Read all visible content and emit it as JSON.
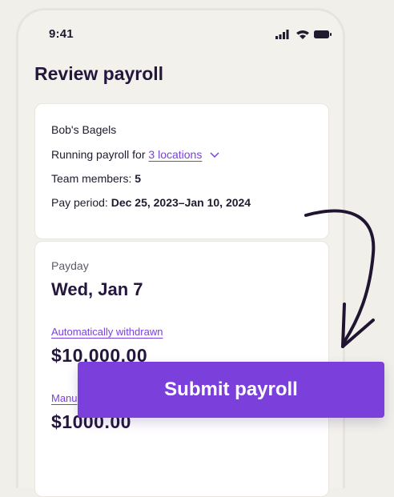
{
  "status_bar": {
    "time": "9:41",
    "icons": [
      "signal-icon",
      "wifi-icon",
      "battery-icon"
    ]
  },
  "page": {
    "title": "Review payroll"
  },
  "summary_card": {
    "company": "Bob's Bagels",
    "running_prefix": "Running payroll for",
    "locations_link": "3 locations",
    "team_label": "Team members:",
    "team_count": "5",
    "period_label": "Pay period:",
    "period_value": "Dec 25, 2023–Jan 10, 2024"
  },
  "payday_card": {
    "label": "Payday",
    "date": "Wed, Jan 7",
    "auto_label": "Automatically withdrawn",
    "auto_amount": "$10,000.00",
    "manual_label": "Manu",
    "manual_amount": "$1000.00"
  },
  "cta": {
    "submit_label": "Submit payroll"
  },
  "colors": {
    "accent": "#7b3fdc",
    "background": "#f0efe9",
    "text": "#24173d"
  }
}
